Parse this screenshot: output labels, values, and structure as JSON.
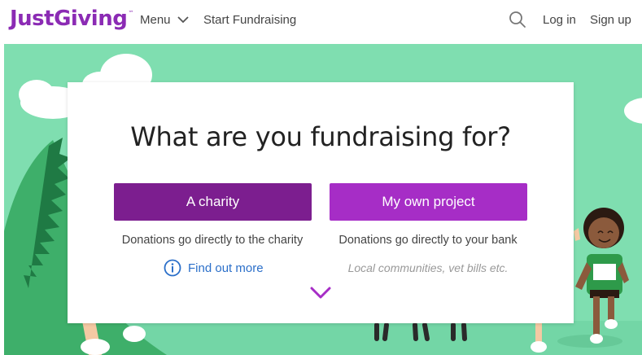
{
  "header": {
    "logo": "JustGiving",
    "logo_tm": "™",
    "menu_label": "Menu",
    "start_label": "Start Fundraising",
    "login_label": "Log in",
    "signup_label": "Sign up"
  },
  "card": {
    "title": "What are you fundraising for?",
    "charity_button": "A charity",
    "project_button": "My own project",
    "charity_desc": "Donations go directly to the charity",
    "project_desc": "Donations go directly to your bank",
    "find_out_more": "Find out more",
    "project_note": "Local communities, vet bills etc."
  },
  "icons": {
    "menu": "chevron-down-icon",
    "search": "search-icon",
    "info": "info-icon",
    "scroll": "chevron-down-icon"
  },
  "colors": {
    "brand": "#8b2bb4",
    "hero": "#7fdeb0",
    "charity_button": "#7c1e8f",
    "project_button": "#a62dc6",
    "link": "#2b6fc9"
  }
}
